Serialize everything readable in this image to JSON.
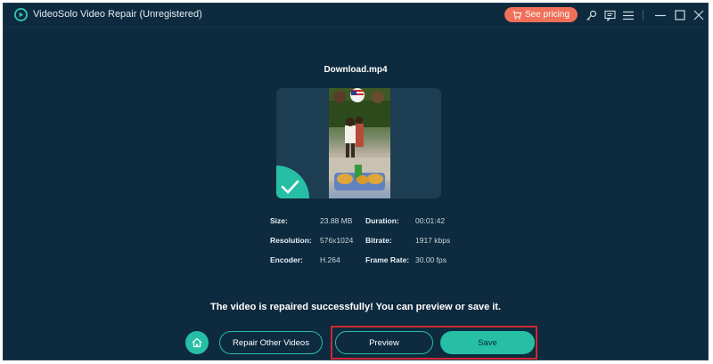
{
  "window": {
    "title": "VideoSolo Video Repair (Unregistered)",
    "pricing_label": "See pricing"
  },
  "main": {
    "filename": "Download.mp4",
    "specs": {
      "size_label": "Size:",
      "size_value": "23.88 MB",
      "duration_label": "Duration:",
      "duration_value": "00:01:42",
      "resolution_label": "Resolution:",
      "resolution_value": "576x1024",
      "bitrate_label": "Bitrate:",
      "bitrate_value": "1917 kbps",
      "encoder_label": "Encoder:",
      "encoder_value": "H.264",
      "framerate_label": "Frame Rate:",
      "framerate_value": "30.00 fps"
    },
    "message": "The video is repaired successfully! You can preview or save it."
  },
  "actions": {
    "repair_other_label": "Repair Other Videos",
    "preview_label": "Preview",
    "save_label": "Save"
  },
  "colors": {
    "background": "#0d2a3e",
    "accent": "#26bfa5",
    "pricing": "#f0705a",
    "highlight": "#d0282e"
  },
  "icons": [
    "logo-icon",
    "cart-icon",
    "key-icon",
    "feedback-icon",
    "menu-icon",
    "minimize-icon",
    "maximize-icon",
    "close-icon",
    "checkmark-icon",
    "home-icon"
  ]
}
